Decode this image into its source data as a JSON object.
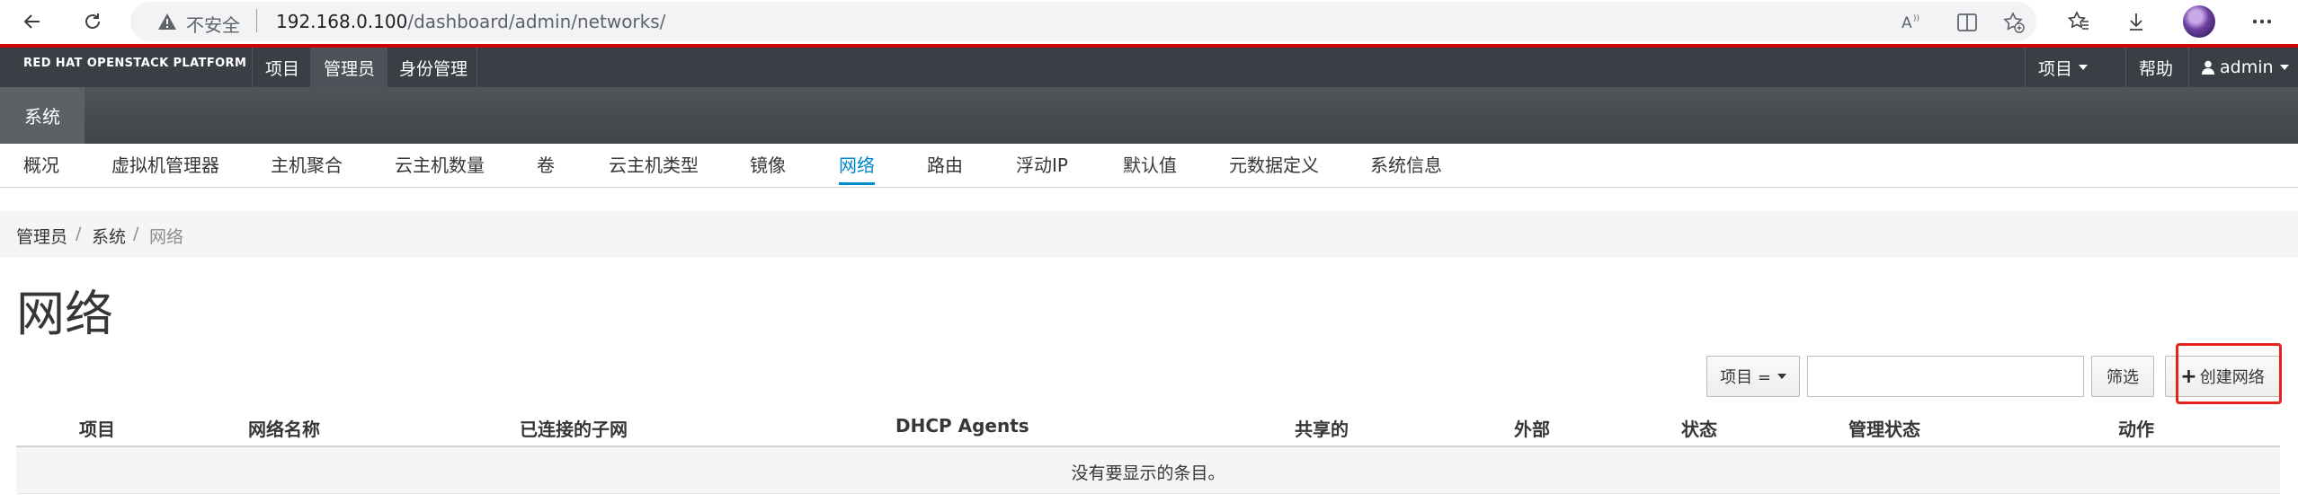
{
  "browser": {
    "insecure_label": "不安全",
    "url_host": "192.168.0.100",
    "url_path": "/dashboard/admin/networks/"
  },
  "masthead": {
    "brand": "RED HAT OPENSTACK PLATFORM",
    "nav": [
      "项目",
      "管理员",
      "身份管理"
    ],
    "active_nav": "管理员",
    "right": {
      "project_menu": "项目",
      "help": "帮助",
      "user": "admin"
    }
  },
  "subnav": {
    "active": "系统"
  },
  "tabs": [
    "概况",
    "虚拟机管理器",
    "主机聚合",
    "云主机数量",
    "卷",
    "云主机类型",
    "镜像",
    "网络",
    "路由",
    "浮动IP",
    "默认值",
    "元数据定义",
    "系统信息"
  ],
  "active_tab": "网络",
  "breadcrumb": [
    "管理员",
    "系统",
    "网络"
  ],
  "separators": [
    "/",
    "/"
  ],
  "page_title": "网络",
  "toolbar": {
    "filter_field": "项目 =",
    "filter_value": "",
    "filter_button": "筛选",
    "create_button": "创建网络",
    "create_plus": "+"
  },
  "table": {
    "columns": [
      "项目",
      "网络名称",
      "已连接的子网",
      "DHCP Agents",
      "共享的",
      "外部",
      "状态",
      "管理状态",
      "动作"
    ],
    "rows": [],
    "empty_message": "没有要显示的条目。"
  },
  "colors": {
    "masthead_bg": "#393f44",
    "accent_red": "#cc0000",
    "active_tab": "#0088ce",
    "highlight": "#e8221c"
  }
}
